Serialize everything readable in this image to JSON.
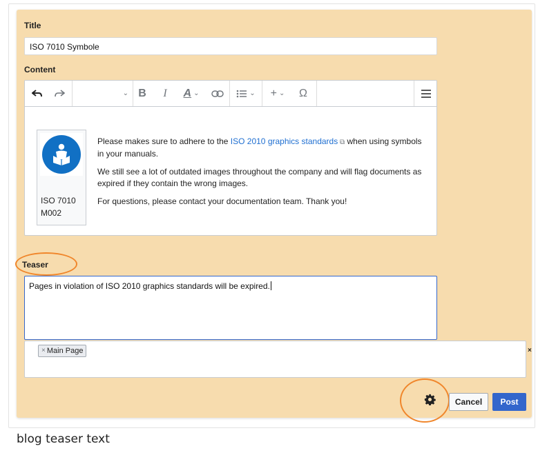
{
  "form": {
    "title_label": "Title",
    "title_value": "ISO 7010 Symbole",
    "content_label": "Content",
    "teaser_label": "Teaser",
    "teaser_value": "Pages in violation of ISO 2010 graphics standards will be expired."
  },
  "toolbar": {
    "icons": [
      "undo-icon",
      "redo-icon",
      "format-dropdown",
      "bold-icon",
      "italic-icon",
      "text-style-icon",
      "link-icon",
      "list-icon",
      "insert-icon",
      "special-character-icon",
      "menu-icon"
    ],
    "bold": "B",
    "italic": "I",
    "text_style": "A",
    "insert": "+",
    "special_char": "Ω"
  },
  "content": {
    "image_caption_line1": "ISO 7010",
    "image_caption_line2": "M002",
    "p1_before": "Please makes sure to adhere to the ",
    "p1_link": "ISO 2010 graphics standards",
    "p1_after": " when using symbols in your manuals.",
    "p2": "We still see a lot of outdated images throughout the company and will flag documents as expired if they contain the wrong images.",
    "p3": "For questions, please contact your documentation team. Thank you!"
  },
  "categories": {
    "chips": [
      "Main Page"
    ],
    "remove_glyph": "×",
    "clear_glyph": "×"
  },
  "actions": {
    "cancel_label": "Cancel",
    "post_label": "Post"
  },
  "caption": "blog teaser text",
  "colors": {
    "panel": "#f7dcae",
    "link": "#1f6fd1",
    "primary": "#3366cc",
    "highlight": "#f0862b",
    "mandatory_blue": "#1170c4"
  }
}
